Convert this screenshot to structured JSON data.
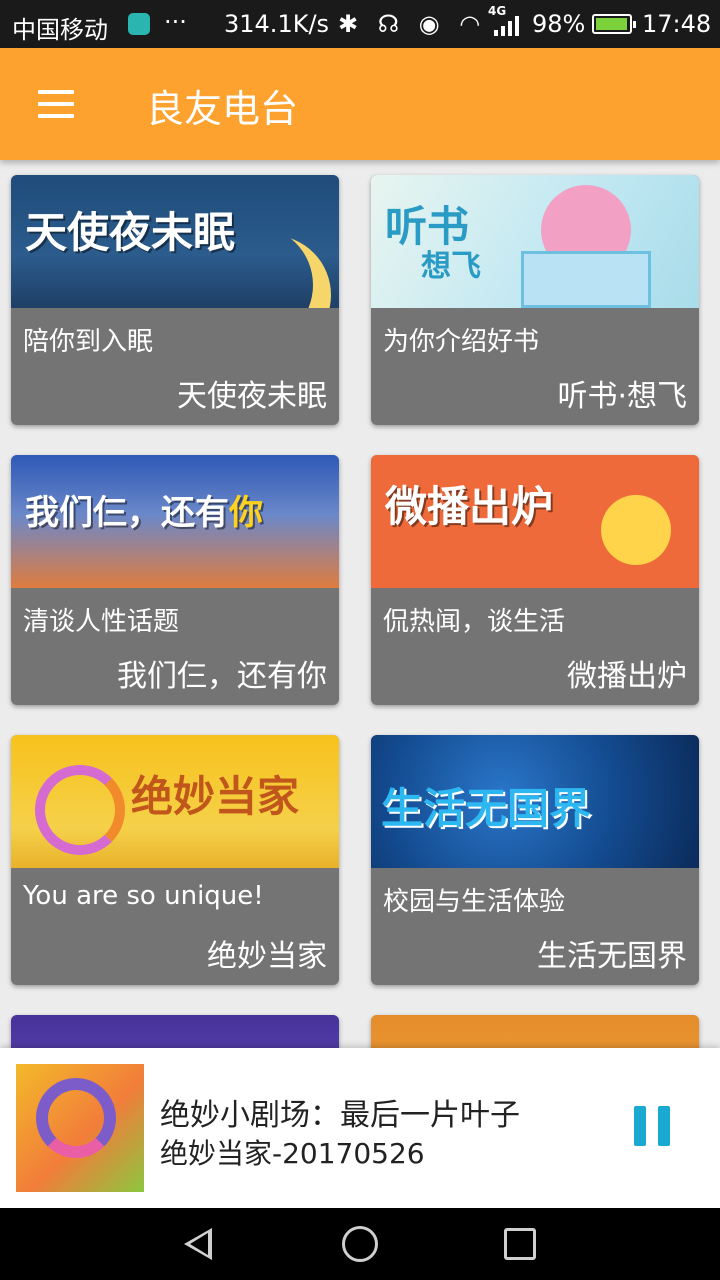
{
  "status_bar": {
    "carrier": "中国移动",
    "more": "···",
    "speed": "314.1K/s",
    "icons": "✱ ☊ ◉ ◠",
    "network": "4G",
    "battery_pct": "98%",
    "time": "17:48"
  },
  "app_bar": {
    "title": "良友电台",
    "menu_icon": "hamburger-menu-icon"
  },
  "cards": [
    {
      "banner": "天使夜未眠",
      "caption": "陪你到入眠",
      "name": "天使夜未眠"
    },
    {
      "banner": "听书",
      "banner_sub": "想飞",
      "caption": "为你介绍好书",
      "name": "听书·想飞"
    },
    {
      "banner_prefix": "我们仨，还有",
      "banner_highlight": "你",
      "caption": "清谈人性话题",
      "name": "我们仨，还有你"
    },
    {
      "banner": "微播出炉",
      "caption": "侃热闻，谈生活",
      "name": "微播出炉"
    },
    {
      "banner": "绝妙当家",
      "caption": "You are so unique!",
      "name": "绝妙当家"
    },
    {
      "banner": "生活无国界",
      "caption": "校园与生活体验",
      "name": "生活无国界"
    }
  ],
  "player": {
    "title": "绝妙小剧场：最后一片叶子",
    "subtitle": "绝妙当家-20170526",
    "pause_icon": "pause-icon"
  },
  "nav_bar": {
    "back_icon": "back-triangle-icon",
    "home_icon": "home-circle-icon",
    "recents_icon": "recents-square-icon"
  }
}
